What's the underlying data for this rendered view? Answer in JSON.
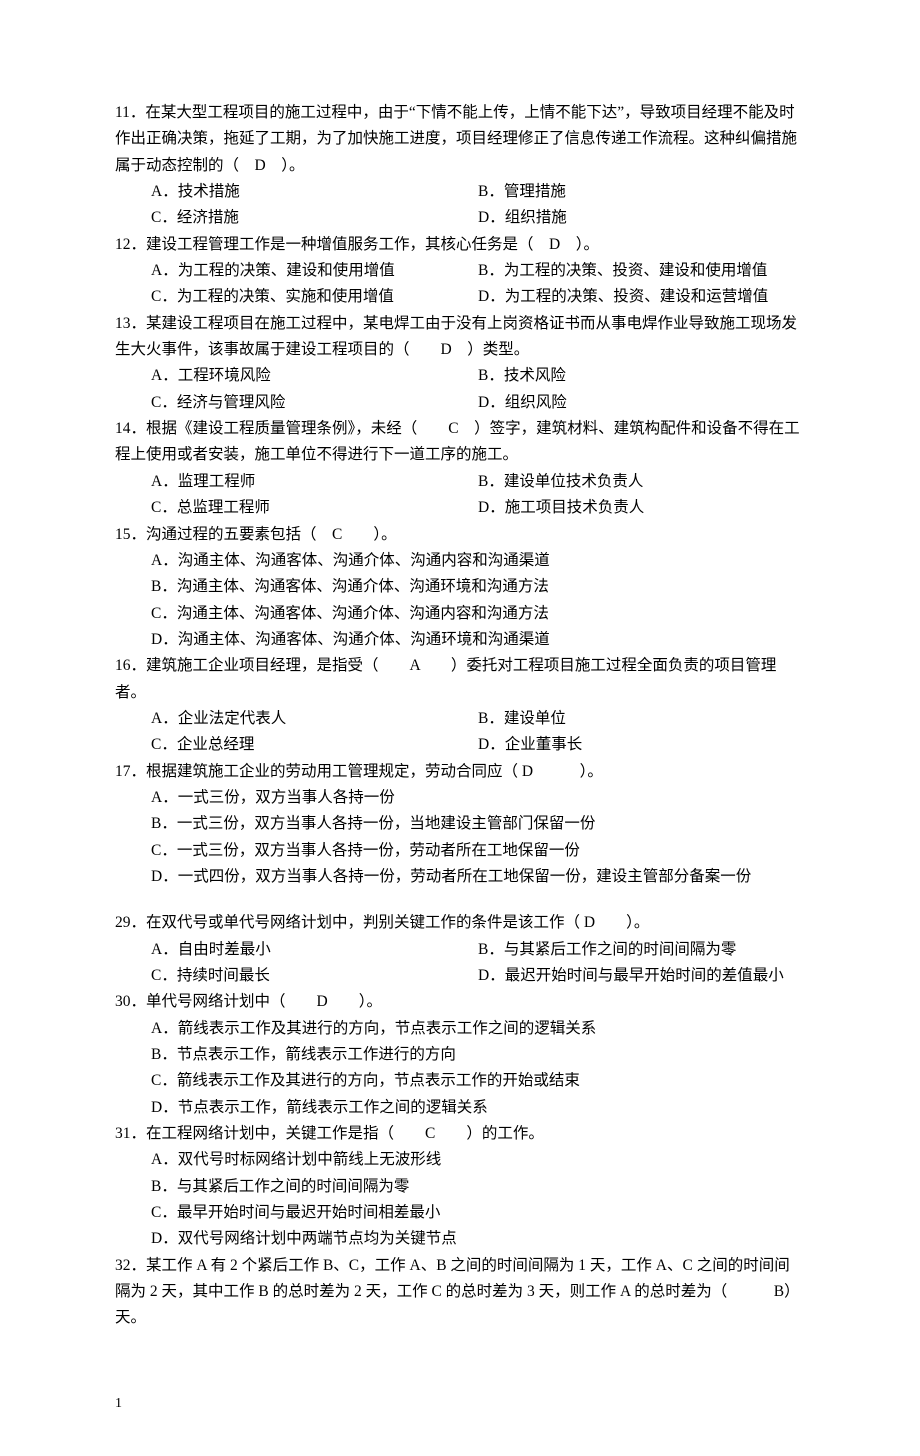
{
  "questions": [
    {
      "num": "11",
      "text": "．在某大型工程项目的施工过程中，由于“下情不能上传，上情不能下达”，导致项目经理不能及时作出正确决策，拖延了工期，为了加快施工进度，项目经理修正了信息传递工作流程。这种纠偏措施属于动态控制的（　D　）。",
      "layout": "2col",
      "opts": {
        "A": "技术措施",
        "B": "管理措施",
        "C": "经济措施",
        "D": "组织措施"
      }
    },
    {
      "num": "12",
      "text": "．建设工程管理工作是一种增值服务工作，其核心任务是（　D　）。",
      "layout": "2col",
      "opts": {
        "A": "为工程的决策、建设和使用增值",
        "B": "为工程的决策、投资、建设和使用增值",
        "C": "为工程的决策、实施和使用增值",
        "D": "为工程的决策、投资、建设和运营增值"
      }
    },
    {
      "num": "13",
      "text": "．某建设工程项目在施工过程中，某电焊工由于没有上岗资格证书而从事电焊作业导致施工现场发生大火事件，该事故属于建设工程项目的（　　D　）类型。",
      "layout": "2col",
      "opts": {
        "A": "工程环境风险",
        "B": "技术风险",
        "C": "经济与管理风险",
        "D": "组织风险"
      }
    },
    {
      "num": "14",
      "text": "．根据《建设工程质量管理条例》，未经（　　C　）签字，建筑材料、建筑构配件和设备不得在工程上使用或者安装，施工单位不得进行下一道工序的施工。",
      "layout": "2col",
      "opts": {
        "A": "监理工程师",
        "B": "建设单位技术负责人",
        "C": "总监理工程师",
        "D": "施工项目技术负责人"
      }
    },
    {
      "num": "15",
      "text": "．沟通过程的五要素包括（　C　　）。",
      "layout": "1col",
      "opts": {
        "A": "沟通主体、沟通客体、沟通介体、沟通内容和沟通渠道",
        "B": "沟通主体、沟通客体、沟通介体、沟通环境和沟通方法",
        "C": "沟通主体、沟通客体、沟通介体、沟通内容和沟通方法",
        "D": "沟通主体、沟通客体、沟通介体、沟通环境和沟通渠道"
      }
    },
    {
      "num": "16",
      "text": "．建筑施工企业项目经理，是指受（　　A　　）委托对工程项目施工过程全面负责的项目管理者。",
      "layout": "2col",
      "opts": {
        "A": "企业法定代表人",
        "B": "建设单位",
        "C": "企业总经理",
        "D": "企业董事长"
      }
    },
    {
      "num": "17",
      "text": "．根据建筑施工企业的劳动用工管理规定，劳动合同应（ D　　　）。",
      "layout": "1col",
      "opts": {
        "A": "一式三份，双方当事人各持一份",
        "B": "一式三份，双方当事人各持一份，当地建设主管部门保留一份",
        "C": "一式三份，双方当事人各持一份，劳动者所在工地保留一份",
        "D": "一式四份，双方当事人各持一份，劳动者所在工地保留一份，建设主管部分备案一份"
      }
    },
    {
      "num": "29",
      "text": "．在双代号或单代号网络计划中，判别关键工作的条件是该工作（ D　　）。",
      "layout": "2col",
      "opts": {
        "A": "自由时差最小",
        "B": "与其紧后工作之间的时间间隔为零",
        "C": "持续时间最长",
        "D": "最迟开始时间与最早开始时间的差值最小"
      }
    },
    {
      "num": "30",
      "text": "．单代号网络计划中（　　D　　）。",
      "layout": "1col",
      "opts": {
        "A": "箭线表示工作及其进行的方向，节点表示工作之间的逻辑关系",
        "B": "节点表示工作，箭线表示工作进行的方向",
        "C": "箭线表示工作及其进行的方向，节点表示工作的开始或结束",
        "D": "节点表示工作，箭线表示工作之间的逻辑关系"
      }
    },
    {
      "num": "31",
      "text": "．在工程网络计划中，关键工作是指（　　C　　）的工作。",
      "layout": "1col",
      "opts": {
        "A": "双代号时标网络计划中箭线上无波形线",
        "B": "与其紧后工作之间的时间间隔为零",
        "C": "最早开始时间与最迟开始时间相差最小",
        "D": "双代号网络计划中两端节点均为关键节点"
      }
    },
    {
      "num": "32",
      "text": "．某工作 A 有 2 个紧后工作 B、C，工作 A、B 之间的时间间隔为 1 天，工作 A、C 之间的时间间隔为 2 天，其中工作 B 的总时差为 2 天，工作 C 的总时差为 3 天，则工作 A 的总时差为（　　　B）天。",
      "layout": "none",
      "opts": {}
    }
  ],
  "page_number": "1"
}
